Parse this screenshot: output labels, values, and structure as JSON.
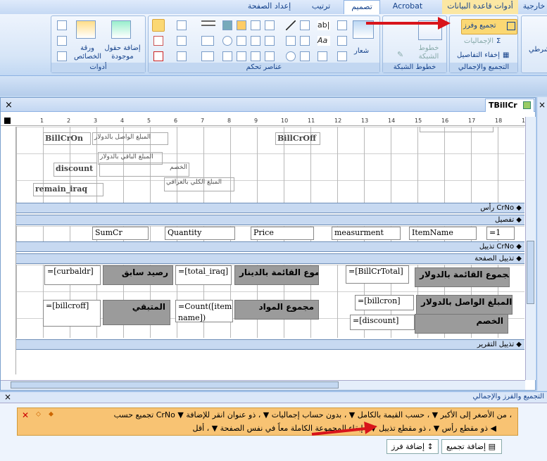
{
  "ribbon_tabs": [
    "خارجية",
    "أدوات قاعدة البيانات",
    "Acrobat",
    "تصميم",
    "ترتيب",
    "إعداد الصفحة"
  ],
  "active_tab": "تصميم",
  "groups": {
    "grouping": {
      "label": "التجميع والإجمالي",
      "group_sort": "تجميع وفرز",
      "totals": "الإجماليات",
      "hide_details": "إخفاء التفاصيل"
    },
    "gridlines": {
      "label": "خطوط الشبكة",
      "gridlines_btn": "خطوط الشبكة"
    },
    "controls": {
      "label": "عناصر تحكم",
      "logo": "شعار"
    },
    "tools": {
      "label": "أدوات",
      "add_fields": "إضافة حقول موجودة",
      "property_sheet": "ورقة الخصائص"
    },
    "left_partial": "شرطي"
  },
  "doc": {
    "tab_title": "TBillCr",
    "close": "×"
  },
  "ruler": [
    "1",
    "2",
    "3",
    "4",
    "5",
    "6",
    "7",
    "8",
    "9",
    "10",
    "11",
    "12",
    "13",
    "14",
    "15",
    "16",
    "17",
    "18",
    "19"
  ],
  "sections": {
    "group_header": "رأس CrNo",
    "detail": "تفصيل",
    "group_footer": "تذييل CrNo",
    "page_footer": "تذييل الصفحة",
    "report_footer": "تذييل التقرير"
  },
  "page_header_controls": {
    "billcron": "BillCrOn",
    "paid_usd_lbl": "المبلغ  الواصل بالدولار",
    "billcroff": "BillCrOff",
    "remaining_usd_lbl": "المبلغ الباقي بالدولار",
    "discount": "discount",
    "discount_lbl": "الخصم",
    "remain_iraq": "remain_iraq",
    "total_iraqi_lbl": "المبلغ الكلي بالعراقي"
  },
  "detail_controls": {
    "sumcr": "SumCr",
    "quantity": "Quantity",
    "price": "Price",
    "measurement": "measurment",
    "itemname": "ItemName",
    "one": "=1"
  },
  "footer_controls": {
    "curbaldr": "=[curbaldr]",
    "prev_balance": "رصيد سابق",
    "total_iraq": "=[total_iraq]",
    "total_iqd": "مجموع القائمة بالدينار",
    "billcrtotal": "=[BillCrTotal]",
    "total_usd": "مجموع القائمة بالدولار",
    "billcroff": "=[billcroff]",
    "remaining": "المتبقي",
    "count_item": "=Count([item name])",
    "items_total": "مجموع المواد",
    "billcron": "=[billcron]",
    "paid_usd": "المبلغ الواصل بالدولار",
    "discount": "=[discount]",
    "discount_lbl": "الخصم"
  },
  "group_pane": {
    "title": "التجميع والفرز والإجمالي",
    "row1": "تجميع حسب  CrNo ▼  من الأصغر إلى الأكبر ▼ ، حسب القيمة بالكامل ▼ ، بدون حساب إجماليات ▼ ، ذو عنوان انقر للإضافة ،",
    "row2": "ذو مقطع رأس ▼ ، ذو مقطع تذييل ▼ ، إبقاء المجموعة الكاملة معاً في نفس الصفحة ▼ ، أقل ◀",
    "add_sort": "إضافة فرز",
    "add_group": "إضافة تجميع"
  }
}
